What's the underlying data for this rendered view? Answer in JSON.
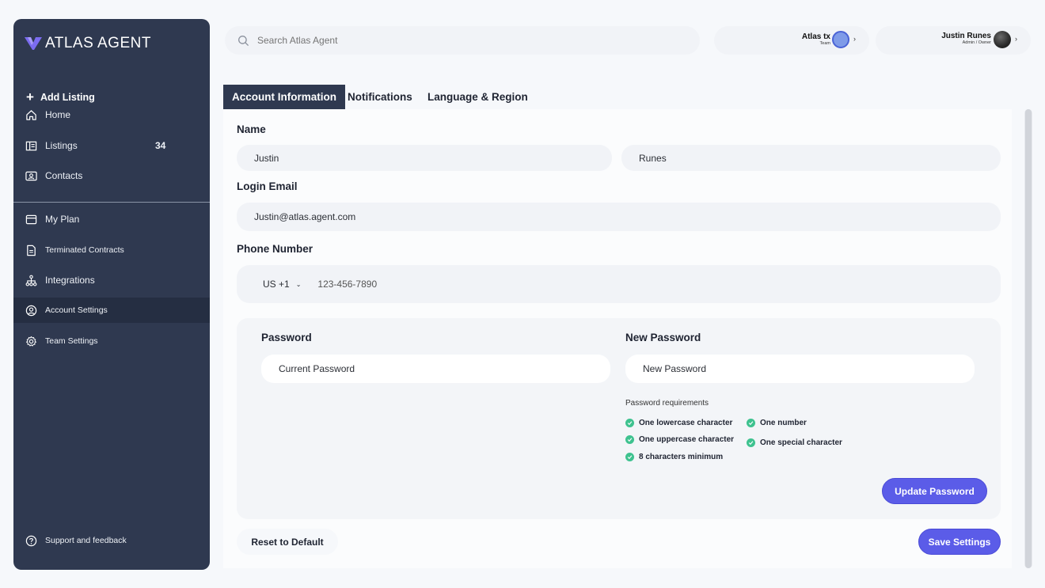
{
  "brand": {
    "name": "ATLAS AGENT"
  },
  "sidebar": {
    "add_listing": "Add Listing",
    "items": [
      {
        "label": "Home",
        "icon": "home-icon"
      },
      {
        "label": "Listings",
        "icon": "listings-icon",
        "count": "34"
      },
      {
        "label": "Contacts",
        "icon": "contacts-icon"
      },
      {
        "label": "My Plan",
        "icon": "plan-icon"
      },
      {
        "label": "Terminated Contracts",
        "icon": "document-icon"
      },
      {
        "label": "Integrations",
        "icon": "integrations-icon"
      },
      {
        "label": "Account Settings",
        "icon": "account-icon",
        "active": true
      },
      {
        "label": "Team Settings",
        "icon": "gear-icon"
      }
    ],
    "support": "Support and feedback"
  },
  "header": {
    "search_placeholder": "Search Atlas Agent",
    "team": {
      "name": "Atlas tx",
      "role": "Team"
    },
    "user": {
      "name": "Justin Runes",
      "role": "Admin / Owner"
    }
  },
  "tabs": [
    {
      "label": "Account Information",
      "active": true
    },
    {
      "label": "Notifications"
    },
    {
      "label": "Language & Region"
    }
  ],
  "form": {
    "name_label": "Name",
    "first_name": "Justin",
    "last_name": "Runes",
    "email_label": "Login Email",
    "email": "Justin@atlas.agent.com",
    "phone_label": "Phone Number",
    "country_code": "US +1",
    "phone": "123-456-7890",
    "password_label": "Password",
    "current_password_placeholder": "Current Password",
    "new_password_label": "New Password",
    "new_password_placeholder": "New Password",
    "requirements_title": "Password requirements",
    "requirements": [
      "One lowercase character",
      "One uppercase character",
      "8 characters minimum",
      "One number",
      "One special character"
    ],
    "update_password": "Update Password",
    "reset": "Reset to Default",
    "save": "Save Settings"
  },
  "colors": {
    "sidebar_bg": "#2f3950",
    "accent": "#5b5ce8",
    "check": "#3ec28f",
    "page_bg": "#f6f8fb"
  }
}
